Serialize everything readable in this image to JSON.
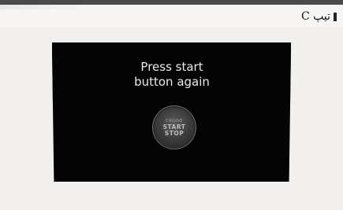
{
  "caption": {
    "text": "تیپ C"
  },
  "display": {
    "line1": "Press start",
    "line2": "button again"
  },
  "start_button": {
    "line1": "ENGINE",
    "line2": "START",
    "line3": "STOP"
  }
}
